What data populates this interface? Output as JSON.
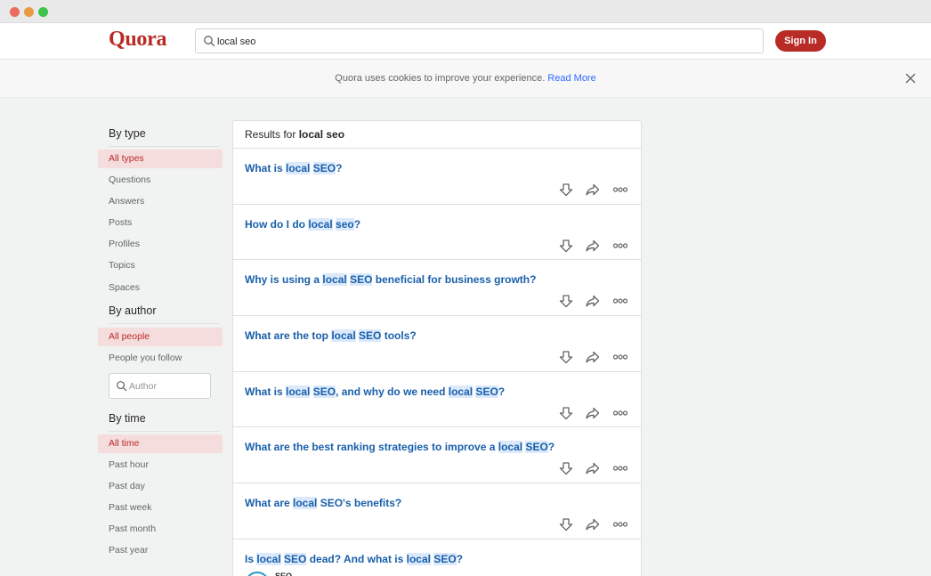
{
  "window": {
    "controls": [
      "close",
      "minimize",
      "maximize"
    ]
  },
  "header": {
    "logo": "Quora",
    "search_value": "local seo",
    "signin_label": "Sign In"
  },
  "cookie": {
    "text": "Quora uses cookies to improve your experience.",
    "link": "Read More"
  },
  "sidebar": {
    "by_type": "By type",
    "types": [
      "All types",
      "Questions",
      "Answers",
      "Posts",
      "Profiles",
      "Topics",
      "Spaces"
    ],
    "by_author": "By author",
    "authors": [
      "All people",
      "People you follow"
    ],
    "author_placeholder": "Author",
    "by_time": "By time",
    "times": [
      "All time",
      "Past hour",
      "Past day",
      "Past week",
      "Past month",
      "Past year"
    ]
  },
  "results": {
    "prefix": "Results for",
    "query": "local seo",
    "items": [
      {
        "title": [
          [
            "What is ",
            false
          ],
          [
            "local",
            true
          ],
          [
            " ",
            false
          ],
          [
            "SEO",
            true
          ],
          [
            "?",
            false
          ]
        ]
      },
      {
        "title": [
          [
            "How do I do ",
            false
          ],
          [
            "local",
            true
          ],
          [
            " ",
            false
          ],
          [
            "seo",
            true
          ],
          [
            "?",
            false
          ]
        ]
      },
      {
        "title": [
          [
            "Why is using a ",
            false
          ],
          [
            "local",
            true
          ],
          [
            " ",
            false
          ],
          [
            "SEO",
            true
          ],
          [
            " beneficial for business growth?",
            false
          ]
        ]
      },
      {
        "title": [
          [
            "What are the top ",
            false
          ],
          [
            "local",
            true
          ],
          [
            " ",
            false
          ],
          [
            "SEO",
            true
          ],
          [
            " tools?",
            false
          ]
        ]
      },
      {
        "title": [
          [
            "What is ",
            false
          ],
          [
            "local",
            true
          ],
          [
            " ",
            false
          ],
          [
            "SEO",
            true
          ],
          [
            ", and why do we need ",
            false
          ],
          [
            "local",
            true
          ],
          [
            " ",
            false
          ],
          [
            "SEO",
            true
          ],
          [
            "?",
            false
          ]
        ]
      },
      {
        "title": [
          [
            "What are the best ranking strategies to improve a ",
            false
          ],
          [
            "local",
            true
          ],
          [
            " ",
            false
          ],
          [
            "SEO",
            true
          ],
          [
            "?",
            false
          ]
        ]
      },
      {
        "title": [
          [
            "What are ",
            false
          ],
          [
            "local",
            true
          ],
          [
            " SEO's benefits?",
            false
          ]
        ]
      },
      {
        "title": [
          [
            "Is ",
            false
          ],
          [
            "local",
            true
          ],
          [
            " ",
            false
          ],
          [
            "SEO",
            true
          ],
          [
            " dead? And what is ",
            false
          ],
          [
            "local",
            true
          ],
          [
            " ",
            false
          ],
          [
            "SEO",
            true
          ],
          [
            "?",
            false
          ]
        ]
      }
    ],
    "peek_text": "SEO"
  },
  "colors": {
    "brand": "#b92b27",
    "link": "#195faa",
    "highlight": "#dbe9fb"
  },
  "icons": [
    "search-icon",
    "close-icon",
    "downvote-icon",
    "share-icon",
    "more-icon"
  ]
}
